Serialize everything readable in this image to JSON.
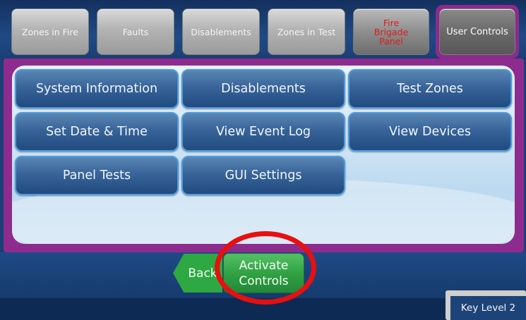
{
  "tabs": [
    {
      "label": "Zones in Fire"
    },
    {
      "label": "Faults"
    },
    {
      "label": "Disablements"
    },
    {
      "label": "Zones in Test"
    },
    {
      "label_lines": [
        "Fire",
        "Brigade",
        "Panel"
      ]
    },
    {
      "label": "User Controls"
    }
  ],
  "menu": {
    "system_information": "System Information",
    "disablements": "Disablements",
    "test_zones": "Test Zones",
    "set_date_time": "Set Date & Time",
    "view_event_log": "View Event Log",
    "view_devices": "View Devices",
    "panel_tests": "Panel Tests",
    "gui_settings": "GUI Settings"
  },
  "footer": {
    "back_label": "Back",
    "activate_line1": "Activate",
    "activate_line2": "Controls",
    "key_level": "Key Level 2"
  },
  "colors": {
    "frame_accent": "#8e2b8f",
    "menu_button": "#2f5d93",
    "action_button": "#2f9f42",
    "highlight_ring": "#e80f0f",
    "fire_text": "#e21b1b"
  }
}
